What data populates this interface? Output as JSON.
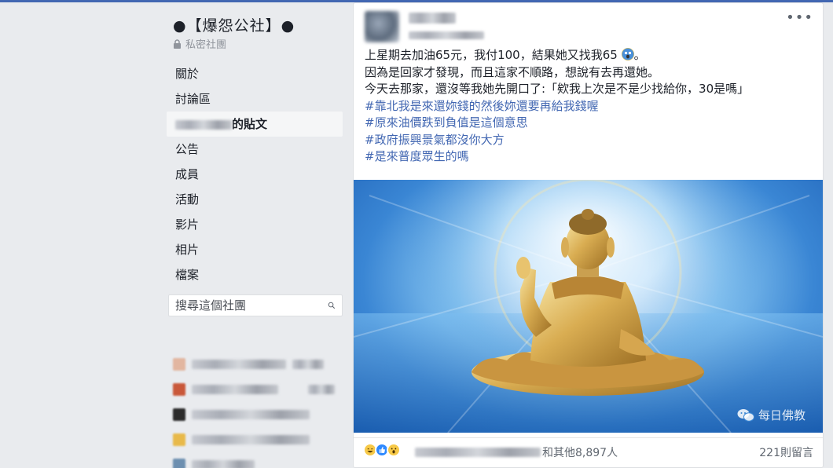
{
  "group": {
    "name": "●【爆怨公社】●",
    "privacy": "私密社團"
  },
  "nav": {
    "about": "關於",
    "discussion": "討論區",
    "my_posts_suffix": "的貼文",
    "announcements": "公告",
    "members": "成員",
    "events": "活動",
    "videos": "影片",
    "photos": "相片",
    "files": "檔案"
  },
  "search": {
    "placeholder": "搜尋這個社團"
  },
  "sidebar_section": {
    "label": ""
  },
  "post": {
    "author": "",
    "line1_before": "上星期去加油65元，我付100，結果她又找我65",
    "line1_after": "。",
    "line2": "因為是回家才發現，而且這家不順路，想說有去再還她。",
    "line3": "今天去那家，還沒等我她先開口了:「欸我上次是不是少找給你，30是嗎」",
    "hashtags": [
      "#靠北我是來還妳錢的然後妳還要再給我錢喔",
      "#原來油價跌到負值是這個意思",
      "#政府振興景氣都沒你大方",
      "#是來普度眾生的嗎"
    ],
    "image_watermark": "每日佛教",
    "reactions_suffix": "和其他8,897人",
    "comments": "221則留言"
  },
  "colors": {
    "link": "#4267b2",
    "page_bg": "#e9ebee",
    "text": "#1d2129",
    "muted": "#90949c"
  },
  "icons": [
    "lock-icon",
    "search-icon",
    "more-options-icon",
    "haha-reaction-icon",
    "like-reaction-icon",
    "wow-reaction-icon",
    "wechat-icon"
  ]
}
